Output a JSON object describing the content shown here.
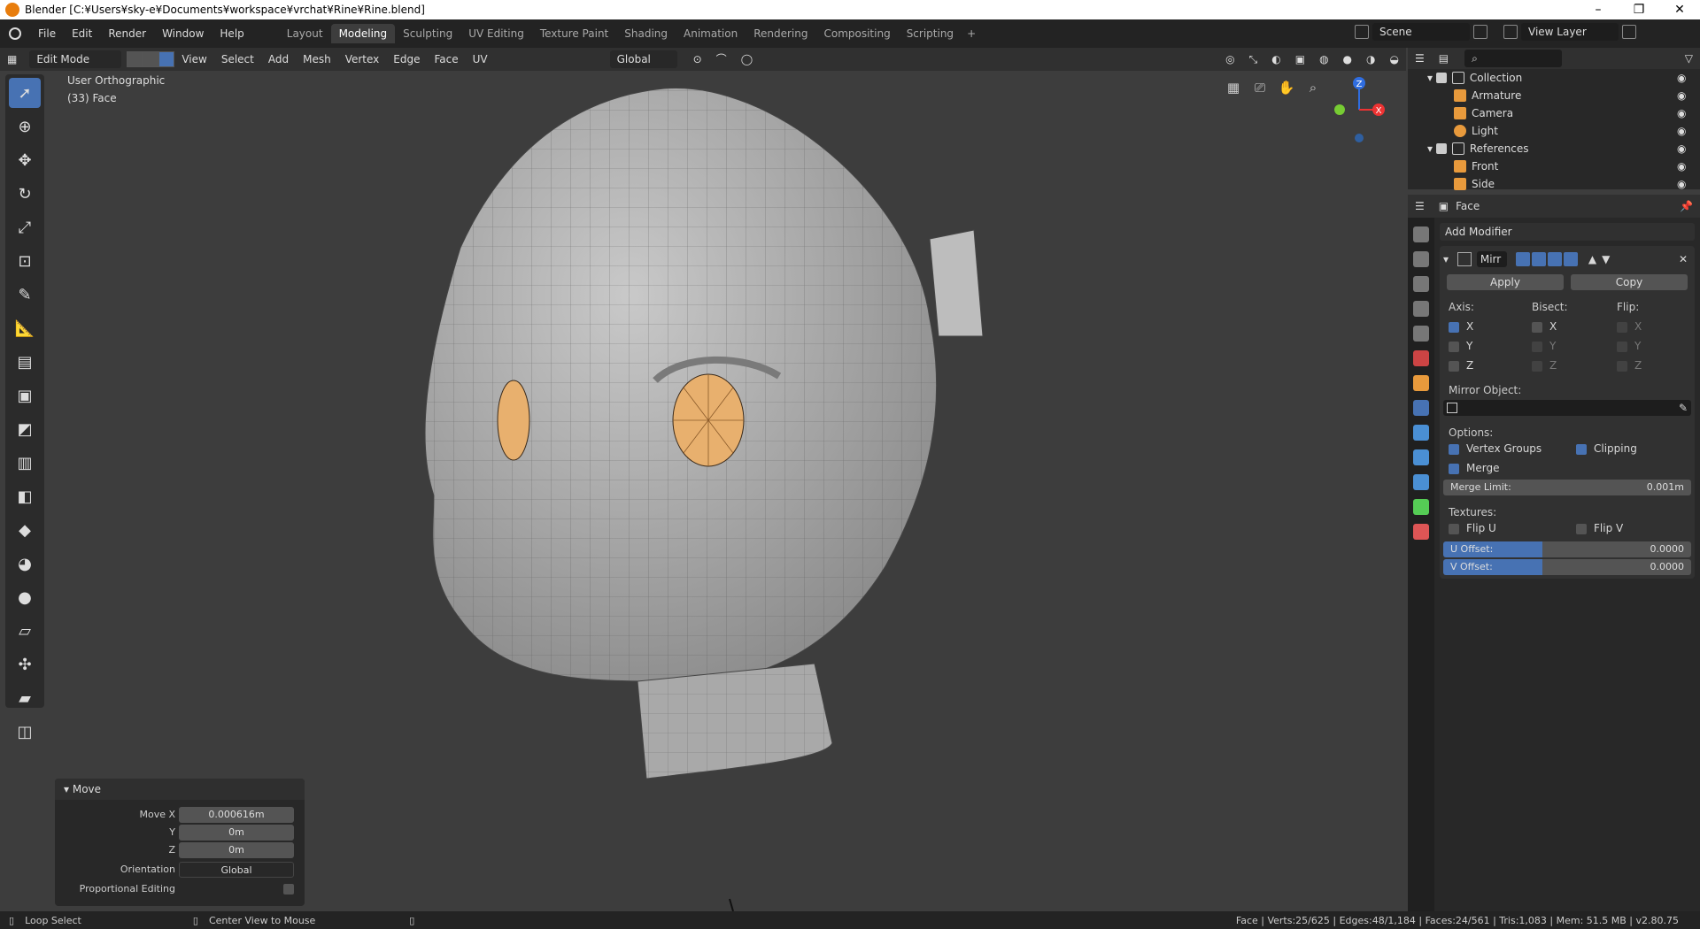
{
  "window": {
    "title": "Blender [C:¥Users¥sky-e¥Documents¥workspace¥vrchat¥Rine¥Rine.blend]"
  },
  "menu": [
    "File",
    "Edit",
    "Render",
    "Window",
    "Help"
  ],
  "workspaces": [
    "Layout",
    "Modeling",
    "Sculpting",
    "UV Editing",
    "Texture Paint",
    "Shading",
    "Animation",
    "Rendering",
    "Compositing",
    "Scripting"
  ],
  "active_workspace": "Modeling",
  "scene": "Scene",
  "view_layer": "View Layer",
  "viewport_header": {
    "mode": "Edit Mode",
    "menus": [
      "View",
      "Select",
      "Add",
      "Mesh",
      "Vertex",
      "Edge",
      "Face",
      "UV"
    ],
    "orientation": "Global"
  },
  "viewport": {
    "view_name": "User Orthographic",
    "selection": "(33) Face"
  },
  "gizmo": {
    "z": "Z",
    "x": "X"
  },
  "move_panel": {
    "title": "Move",
    "move_x_label": "Move X",
    "move_x": "0.000616m",
    "y_label": "Y",
    "y": "0m",
    "z_label": "Z",
    "z": "0m",
    "orientation_label": "Orientation",
    "orientation": "Global",
    "proportional_label": "Proportional Editing"
  },
  "outliner": {
    "items": [
      {
        "name": "Collection",
        "depth": 0,
        "color": "#cccccc"
      },
      {
        "name": "Armature",
        "depth": 1,
        "color": "#e89a3c"
      },
      {
        "name": "Camera",
        "depth": 1,
        "color": "#e89a3c"
      },
      {
        "name": "Light",
        "depth": 1,
        "color": "#e89a3c"
      },
      {
        "name": "References",
        "depth": 0,
        "color": "#cccccc"
      },
      {
        "name": "Front",
        "depth": 1,
        "color": "#e89a3c"
      },
      {
        "name": "Side",
        "depth": 1,
        "color": "#e89a3c"
      }
    ]
  },
  "properties": {
    "object": "Face",
    "add_modifier": "Add Modifier",
    "modifier_name": "Mirr",
    "apply": "Apply",
    "copy": "Copy",
    "axis_label": "Axis:",
    "bisect_label": "Bisect:",
    "flip_label": "Flip:",
    "axes": [
      "X",
      "Y",
      "Z"
    ],
    "mirror_object_label": "Mirror Object:",
    "options_label": "Options:",
    "vertex_groups": "Vertex Groups",
    "clipping": "Clipping",
    "merge": "Merge",
    "merge_limit_label": "Merge Limit:",
    "merge_limit": "0.001m",
    "textures_label": "Textures:",
    "flip_u": "Flip U",
    "flip_v": "Flip V",
    "u_offset_label": "U Offset:",
    "u_offset": "0.0000",
    "v_offset_label": "V Offset:",
    "v_offset": "0.0000"
  },
  "statusbar": {
    "left1": "Loop Select",
    "left2": "Center View to Mouse",
    "right": "Face | Verts:25/625 | Edges:48/1,184 | Faces:24/561 | Tris:1,083 | Mem: 51.5 MB | v2.80.75"
  }
}
